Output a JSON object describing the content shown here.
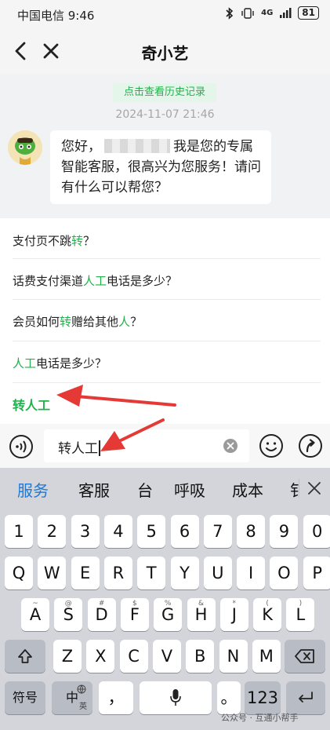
{
  "status": {
    "carrier_time": "中国电信 9:46",
    "signal": "4G",
    "battery": "81"
  },
  "nav": {
    "title": "奇小艺"
  },
  "chat": {
    "history_button": "点击查看历史记录",
    "timestamp": "2024-11-07 21:46",
    "greeting_prefix": "您好，",
    "greeting_suffix": "我是您的专属智能客服，很高兴为您服务！请问有什么可以帮您？"
  },
  "suggestions": [
    {
      "parts": [
        {
          "t": "支付页不跳",
          "h": false
        },
        {
          "t": "转",
          "h": true
        },
        {
          "t": "？",
          "h": false
        }
      ]
    },
    {
      "parts": [
        {
          "t": "话费支付渠道",
          "h": false
        },
        {
          "t": "人工",
          "h": true
        },
        {
          "t": "电话是多少？",
          "h": false
        }
      ]
    },
    {
      "parts": [
        {
          "t": "会员如何",
          "h": false
        },
        {
          "t": "转",
          "h": true
        },
        {
          "t": "赠给其他",
          "h": false
        },
        {
          "t": "人",
          "h": true
        },
        {
          "t": "？",
          "h": false
        }
      ]
    },
    {
      "parts": [
        {
          "t": "人工",
          "h": true
        },
        {
          "t": "电话是多少？",
          "h": false
        }
      ]
    },
    {
      "parts": [
        {
          "t": "转人工",
          "h": true
        }
      ]
    }
  ],
  "input": {
    "value": "转人工"
  },
  "keyboard": {
    "candidates": [
      "服务",
      "客服",
      "台",
      "呼吸",
      "成本",
      "钅"
    ],
    "row_numbers": [
      "1",
      "2",
      "3",
      "4",
      "5",
      "6",
      "7",
      "8",
      "9",
      "0"
    ],
    "row_q": [
      "Q",
      "W",
      "E",
      "R",
      "T",
      "Y",
      "U",
      "I",
      "O",
      "P"
    ],
    "row_a": [
      "A",
      "S",
      "D",
      "F",
      "G",
      "H",
      "J",
      "K",
      "L"
    ],
    "row_a_sub": [
      "~",
      "@",
      "#",
      "$",
      "%",
      "&",
      "*",
      "(",
      ")"
    ],
    "row_z": [
      "Z",
      "X",
      "C",
      "V",
      "B",
      "N",
      "M"
    ],
    "row_z_sub": [
      "",
      "",
      "",
      "",
      "",
      "",
      ""
    ],
    "symbol_key": "符号",
    "lang_key": "中",
    "lang_sub": "英",
    "comma_key": "，",
    "period_key": "。",
    "num_key": "123"
  },
  "watermark": "公众号 · 互通小帮手",
  "colors": {
    "accent": "#22b24c",
    "candidate_active": "#1e78d6",
    "arrow": "#e53935"
  }
}
